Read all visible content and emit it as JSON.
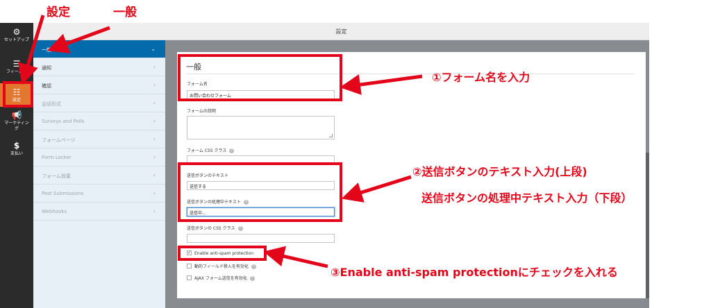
{
  "header": {
    "title": "設定"
  },
  "rail": {
    "items": [
      {
        "label": "セットアップ",
        "icon": "gear-icon"
      },
      {
        "label": "フィールド",
        "icon": "list-icon"
      },
      {
        "label": "設定",
        "icon": "sliders-icon"
      },
      {
        "label": "マーケティング",
        "icon": "megaphone-icon"
      },
      {
        "label": "支払い",
        "icon": "dollar-icon"
      }
    ]
  },
  "menu": {
    "items": [
      {
        "label": "一般"
      },
      {
        "label": "通知"
      },
      {
        "label": "確認"
      },
      {
        "label": "会話形式"
      },
      {
        "label": "Surveys and Polls"
      },
      {
        "label": "フォームページ"
      },
      {
        "label": "Form Locker"
      },
      {
        "label": "フォーム放棄"
      },
      {
        "label": "Post Submissions"
      },
      {
        "label": "Webhooks"
      }
    ]
  },
  "general": {
    "title": "一般",
    "form_name_label": "フォーム名",
    "form_name_value": "お問い合わせフォーム",
    "form_desc_label": "フォームの説明",
    "form_css_label": "フォーム CSS クラス",
    "submit_text_label": "送信ボタンのテキスト",
    "submit_text_value": "送信する",
    "processing_text_label": "送信ボタンの処理中テキスト",
    "processing_text_value": "送信中...",
    "submit_css_label": "送信ボタンの CSS クラス",
    "checkboxes": [
      {
        "label": "Enable anti-spam protection",
        "checked": true
      },
      {
        "label": "動的フィールド移入を有効化",
        "checked": false
      },
      {
        "label": "AJAX フォーム送信を有効化",
        "checked": false
      }
    ]
  },
  "annotations": {
    "settings": "設定",
    "general": "一般",
    "note1": "①フォーム名を入力",
    "note2": "②送信ボタンのテキスト入力(上段)",
    "note2b": "送信ボタンの処理中テキスト入力（下段）",
    "note3": "③Enable anti-spam protectionにチェックを入れる"
  },
  "colors": {
    "accent_blue": "#036aab",
    "active_orange": "#e27730",
    "annotation_red": "#e3061b"
  }
}
